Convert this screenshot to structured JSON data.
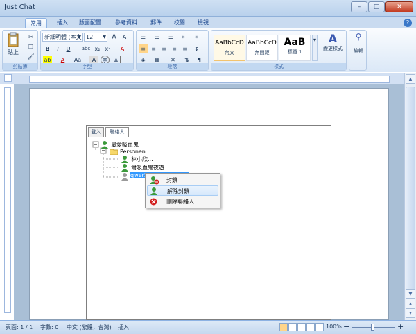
{
  "window": {
    "title": "Just Chat",
    "minimize": "–",
    "maximize": "□",
    "close": "✕"
  },
  "tabs": [
    "常用",
    "插入",
    "版面配置",
    "參考資料",
    "郵件",
    "校閱",
    "檢視"
  ],
  "ribbon": {
    "clipboard": {
      "label": "剪貼簿",
      "paste": "貼上"
    },
    "font": {
      "label": "字型",
      "font_name": "新細明體 (本文",
      "font_size": "12",
      "bold": "B",
      "italic": "I",
      "underline": "U",
      "strike": "abc",
      "sub": "x₂",
      "sup": "x²",
      "aa": "Aa",
      "clear": "A",
      "char_border": "A",
      "grow": "A",
      "shrink": "A"
    },
    "paragraph": {
      "label": "段落"
    },
    "styles": {
      "label": "樣式",
      "items": [
        {
          "preview": "AaBbCcD",
          "name": "內文"
        },
        {
          "preview": "AaBbCcD",
          "name": "無間距"
        },
        {
          "preview": "AaB",
          "name": "標題 1"
        }
      ],
      "change": "變更樣式"
    },
    "editing": {
      "label": "編輯"
    }
  },
  "panel": {
    "tabs": [
      "登入",
      "聯絡人"
    ],
    "tree": {
      "root": "最愛吸血鬼",
      "group": "Personen",
      "contacts": [
        "林小欣...",
        "爾吸血鬼夜遊",
        "qwer53"
      ]
    }
  },
  "context_menu": {
    "items": [
      {
        "icon": "block-contact-icon",
        "label": "封鎖"
      },
      {
        "icon": "unblock-contact-icon",
        "label": "解除封鎖"
      },
      {
        "icon": "delete-icon",
        "label": "刪除聯絡人"
      }
    ]
  },
  "status": {
    "page": "頁面: 1 / 1",
    "words": "字數: 0",
    "lang": "中文 (繁體，台灣)",
    "mode": "插入",
    "zoom": "100%",
    "minus": "−",
    "plus": "+"
  },
  "colors": {
    "accent": "#c9dbf0",
    "contact_green": "#3c9a3c",
    "delete_red": "#d22020",
    "highlight": "#3399ff"
  }
}
